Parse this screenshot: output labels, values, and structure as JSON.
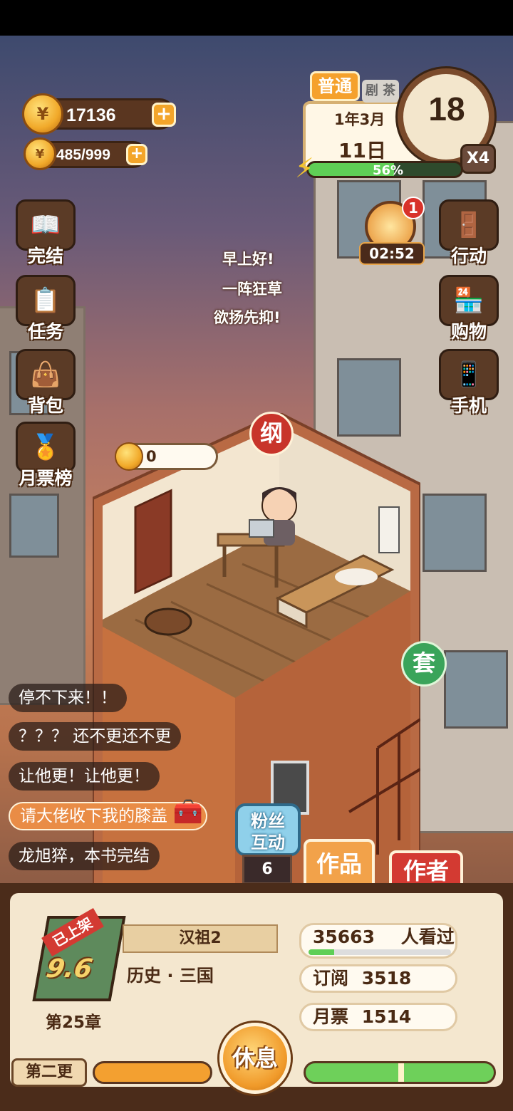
{
  "currency": {
    "coins": "17136",
    "energy_points": "485/999"
  },
  "date_panel": {
    "mode_tag": "普通",
    "partial_sign": "剧 茶",
    "month_label": "1年3月",
    "day_label": "11日",
    "hour": "18",
    "speed": "X4",
    "stamina_percent": "56%",
    "stamina_fraction": 0.56
  },
  "event_timer": {
    "badge": "1",
    "time": "02:52"
  },
  "left_menu": [
    {
      "label": "完结",
      "icon": "book-icon"
    },
    {
      "label": "任务",
      "icon": "checklist-icon"
    },
    {
      "label": "背包",
      "icon": "bag-icon"
    },
    {
      "label": "月票榜",
      "icon": "trophy-coin-icon"
    }
  ],
  "right_menu": [
    {
      "label": "行动",
      "icon": "door-icon"
    },
    {
      "label": "购物",
      "icon": "shop-icon"
    },
    {
      "label": "手机",
      "icon": "phone-icon"
    }
  ],
  "dialog": {
    "line1": "早上好!",
    "line2": "一阵狂草",
    "line3": "欲扬先抑!"
  },
  "room": {
    "outline_badge": "纲",
    "coin_count": "0",
    "set_badge": "套"
  },
  "comments": [
    "停不下来！！",
    "？？？ 还不更还不更",
    "让他更！让他更！",
    "请大佬收下我的膝盖",
    "龙旭猝，本书完结"
  ],
  "fan_interact": {
    "label_line1": "粉丝",
    "label_line2": "互动",
    "count": "6"
  },
  "tabs": {
    "works": "作品",
    "author": "作者"
  },
  "book": {
    "shelf_tag": "已上架",
    "rating": "9.6",
    "title": "汉祖2",
    "genre": "历史 · 三国",
    "chapter": "第25章"
  },
  "stats": {
    "readers_value": "35663",
    "readers_label": "人看过",
    "subscriptions_label": "订阅",
    "subscriptions_value": "3518",
    "monthly_tickets_label": "月票",
    "monthly_tickets_value": "1514"
  },
  "bottom_bar": {
    "update_label": "第二更",
    "rest_button": "休息"
  },
  "colors": {
    "accent_orange": "#f5a12c",
    "brand_brown": "#4b2c1a",
    "green": "#5fcf56",
    "red_badge": "#c8342a"
  }
}
